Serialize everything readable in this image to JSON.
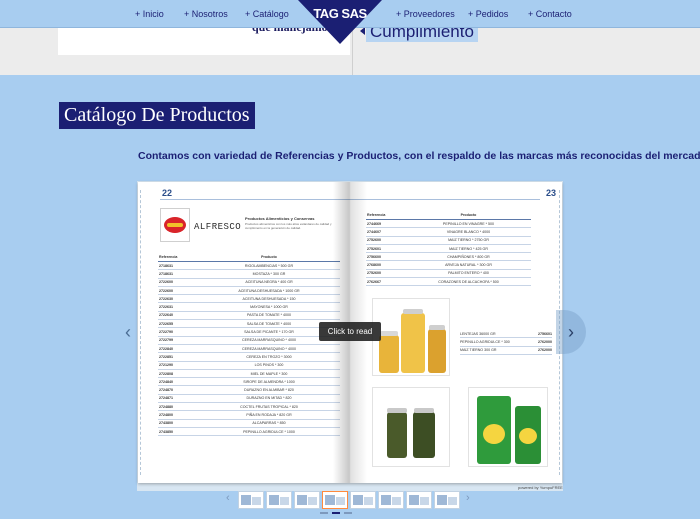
{
  "previous_section": {
    "left_text": "que manejamos.",
    "right_text": "Cumplimiento"
  },
  "nav": {
    "items": [
      {
        "label": "+ Inicio"
      },
      {
        "label": "+ Nosotros"
      },
      {
        "label": "+ Catálogo"
      },
      {
        "label": "+ Proveedores"
      },
      {
        "label": "+ Pedidos"
      },
      {
        "label": "+ Contacto"
      }
    ],
    "logo": "TAG SAS"
  },
  "section": {
    "title": "Catálogo De Productos",
    "subtitle": "Contamos con variedad de Referencias y Productos, con el respaldo de las marcas más reconocidas del mercado."
  },
  "flipbook": {
    "left_page_number": "22",
    "right_page_number": "23",
    "brand_name": "ALFRESCO",
    "brand_title": "Productos Alimenticios y Conservas",
    "brand_desc": "Productos alimenticios con los más altos estándares de calidad y cumplimiento en la generación de calidad.",
    "table_headers": {
      "ref": "Referencia",
      "prod": "Producto"
    },
    "left_rows": [
      {
        "ref": "2718631",
        "prod": "RIGOLAMBENCIAS * 500 GR"
      },
      {
        "ref": "2718631",
        "prod": "MOSTAZA * 300 GR"
      },
      {
        "ref": "2722600",
        "prod": "ACEITUNA NEGRA * 400 GR"
      },
      {
        "ref": "2722600",
        "prod": "ACEITUNA DESHUESADA * 1000 GR"
      },
      {
        "ref": "2722630",
        "prod": "ACEITUNA DESHUESADA * 150"
      },
      {
        "ref": "2722631",
        "prod": "MAYONESA * 1000 GR"
      },
      {
        "ref": "2722640",
        "prod": "PASTA DE TOMATE * 4000"
      },
      {
        "ref": "2722655",
        "prod": "SALSA DE TOMATE * 4000"
      },
      {
        "ref": "2722790",
        "prod": "SALSA DE PICANTE * 170 GR"
      },
      {
        "ref": "2722799",
        "prod": "CEREZA MARRASQUINO * 4000"
      },
      {
        "ref": "2722840",
        "prod": "CEREZA MARRASQUINO * 4000"
      },
      {
        "ref": "2722851",
        "prod": "CEREZA EN TROZO * 3000"
      },
      {
        "ref": "2721290",
        "prod": "LOS PINOS * 300"
      },
      {
        "ref": "2722808",
        "prod": "MIEL DE MAPLE * 300"
      },
      {
        "ref": "2724840",
        "prod": "SIROPE DE ALMENDRA * 1000"
      },
      {
        "ref": "2724870",
        "prod": "DURAZNO EN ALMIBAR * 820"
      },
      {
        "ref": "2724871",
        "prod": "DURAZNO EN MITAD * 820"
      },
      {
        "ref": "2724880",
        "prod": "COCTEL FRUTAS TROPICAL * 820"
      },
      {
        "ref": "2724800",
        "prod": "PIÑA EN RODAJA * 820 GR"
      },
      {
        "ref": "2743800",
        "prod": "ALCAPARRAS * 850"
      },
      {
        "ref": "2743850",
        "prod": "PEPINILLO AGRIDULCE * 1000"
      }
    ],
    "right_rows": [
      {
        "ref": "2744669",
        "prod": "PEPINILLO EN VINAGRE * 500"
      },
      {
        "ref": "2744607",
        "prod": "VINAGRE BLANCO * 4000"
      },
      {
        "ref": "2752600",
        "prod": "MAIZ TIERNO * 2750 GR"
      },
      {
        "ref": "2752601",
        "prod": "MAIZ TIERNO * 425 GR"
      },
      {
        "ref": "2756600",
        "prod": "CHAMPIÑONES * 800 GR"
      },
      {
        "ref": "2768600",
        "prod": "ARVEJA NATURAL * 300 GR"
      },
      {
        "ref": "2752600",
        "prod": "PALMITO ENTERO * 400"
      },
      {
        "ref": "2762667",
        "prod": "CORAZONES DE ALCACHOFA * 500"
      }
    ],
    "side_rows": [
      {
        "prod": "LENTEJAS 36000 GR",
        "ref": "2756601"
      },
      {
        "prod": "PEPINILLO AGRIDULCE * 300",
        "ref": "2762000"
      },
      {
        "prod": "MAIZ TIERNO 300 GR",
        "ref": "2762000"
      }
    ],
    "click_to_read": "Click to read",
    "powered": "powered by YumpuFREE",
    "thumbs": 8,
    "active_thumb": 3
  },
  "icons": {
    "prev_arrow": "chevron-left-icon",
    "next_arrow": "chevron-right-icon"
  },
  "colors": {
    "navy": "#1b1f73",
    "sky": "#a8cdf0"
  }
}
